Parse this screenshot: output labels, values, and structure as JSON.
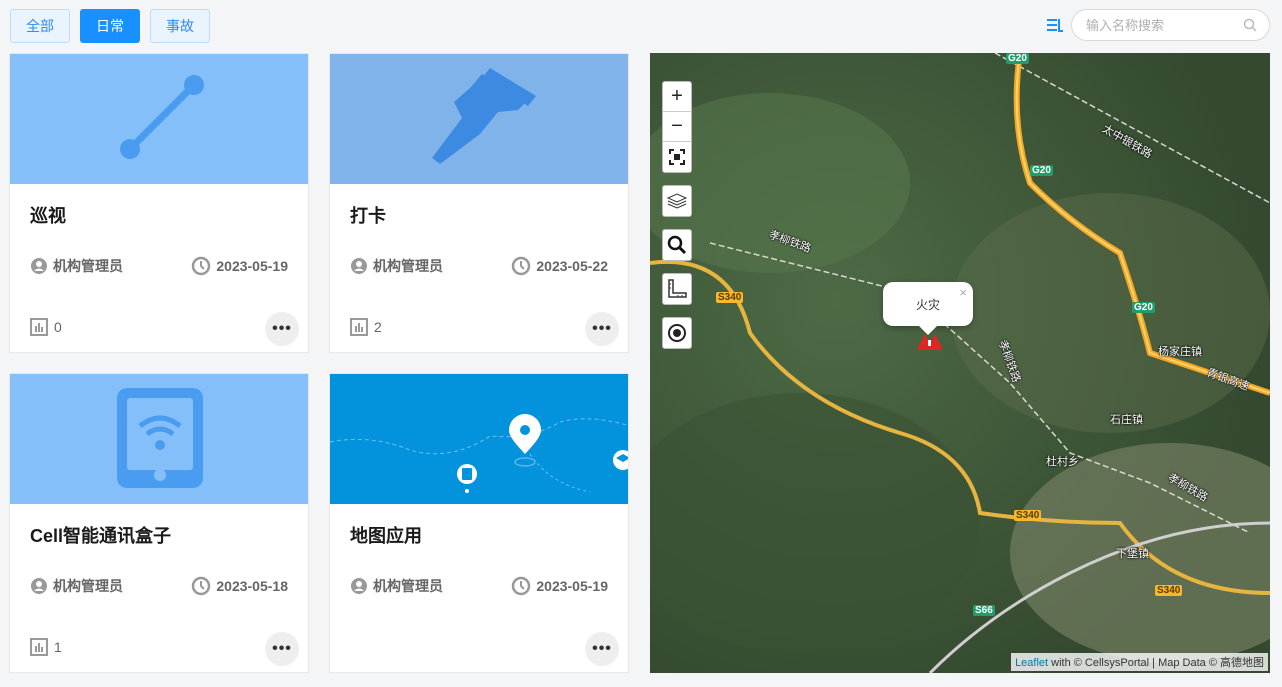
{
  "tabs": [
    {
      "label": "全部",
      "active": false
    },
    {
      "label": "日常",
      "active": true
    },
    {
      "label": "事故",
      "active": false
    }
  ],
  "search": {
    "placeholder": "输入名称搜索"
  },
  "cards": [
    {
      "title": "巡视",
      "author": "机构管理员",
      "date": "2023-05-19",
      "count": "0",
      "banner_color": "#85bff9",
      "icon": "line-segment-icon"
    },
    {
      "title": "打卡",
      "author": "机构管理员",
      "date": "2023-05-22",
      "count": "2",
      "banner_color": "#7fb3ea",
      "icon": "pushpin-icon"
    },
    {
      "title": "Cell智能通讯盒子",
      "author": "机构管理员",
      "date": "2023-05-18",
      "count": "1",
      "banner_color": "#85bff9",
      "icon": "tablet-wifi-icon"
    },
    {
      "title": "地图应用",
      "author": "机构管理员",
      "date": "2023-05-19",
      "count": "",
      "banner_color": "#0392dc",
      "icon": "map-pin-icon"
    }
  ],
  "map": {
    "popup_text": "火灾",
    "close_symbol": "×",
    "attribution": {
      "link": "Leaflet",
      "text": " with © CellsysPortal | Map Data © 高德地图"
    },
    "controls": {
      "zoom_in": "+",
      "zoom_out": "−"
    },
    "road_labels": [
      "G20",
      "G20",
      "G20",
      "S340",
      "S340",
      "S340",
      "S66"
    ],
    "place_labels": [
      "杨家庄镇",
      "石庄镇",
      "杜村乡",
      "下堡镇",
      "青银高速",
      "孝柳铁路",
      "孝柳铁路",
      "太中银铁路",
      "孝柳铁路"
    ]
  },
  "more_label": "•••"
}
